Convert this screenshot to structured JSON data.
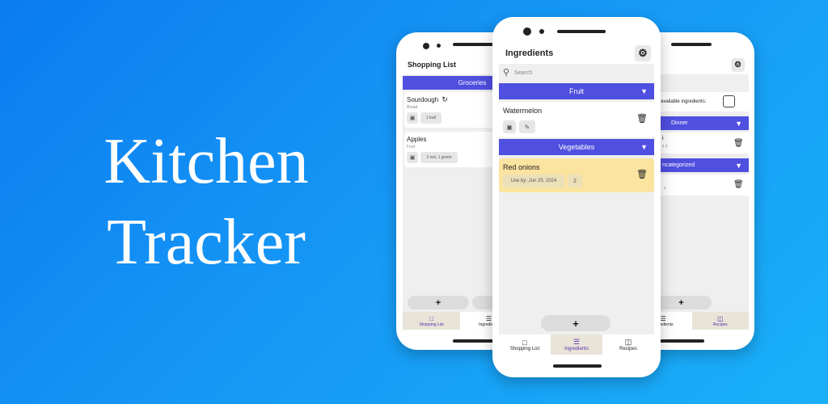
{
  "hero": {
    "line1": "Kitchen",
    "line2": "Tracker"
  },
  "left_phone": {
    "title": "Shopping List",
    "category": "Groceries",
    "items": [
      {
        "name": "Sourdough",
        "category": "Bread",
        "quantity": "1 loaf"
      },
      {
        "name": "Apples",
        "category": "Fruit",
        "quantity": "3 red, 1 green"
      }
    ],
    "add_label": "+",
    "tabs": [
      {
        "label": "Shopping List"
      },
      {
        "label": "Ingredients"
      }
    ]
  },
  "center_phone": {
    "title": "Ingredients",
    "search_placeholder": "Search",
    "categories": [
      {
        "label": "Fruit",
        "items": [
          {
            "name": "Watermelon"
          }
        ]
      },
      {
        "label": "Vegetables",
        "items": [
          {
            "name": "Red onions",
            "use_by": "Use by: Jun 25, 2024",
            "quantity": "2"
          }
        ]
      }
    ],
    "add_label": "+",
    "tabs": [
      {
        "label": "Shopping List"
      },
      {
        "label": "Ingredients"
      },
      {
        "label": "Recipes"
      }
    ],
    "colors": {
      "accent": "#4f4fe0",
      "highlight": "#fbe4a0"
    }
  },
  "right_phone": {
    "filter_label": "available ingredients:",
    "categories": [
      {
        "label": "Dinner"
      },
      {
        "label": "ncategorized"
      }
    ],
    "row1_name": "i",
    "row1_meta": "s 1",
    "row2_meta": "c",
    "add_label": "+",
    "tabs": [
      {
        "label": "Ingredients"
      },
      {
        "label": "Recipes"
      }
    ]
  }
}
